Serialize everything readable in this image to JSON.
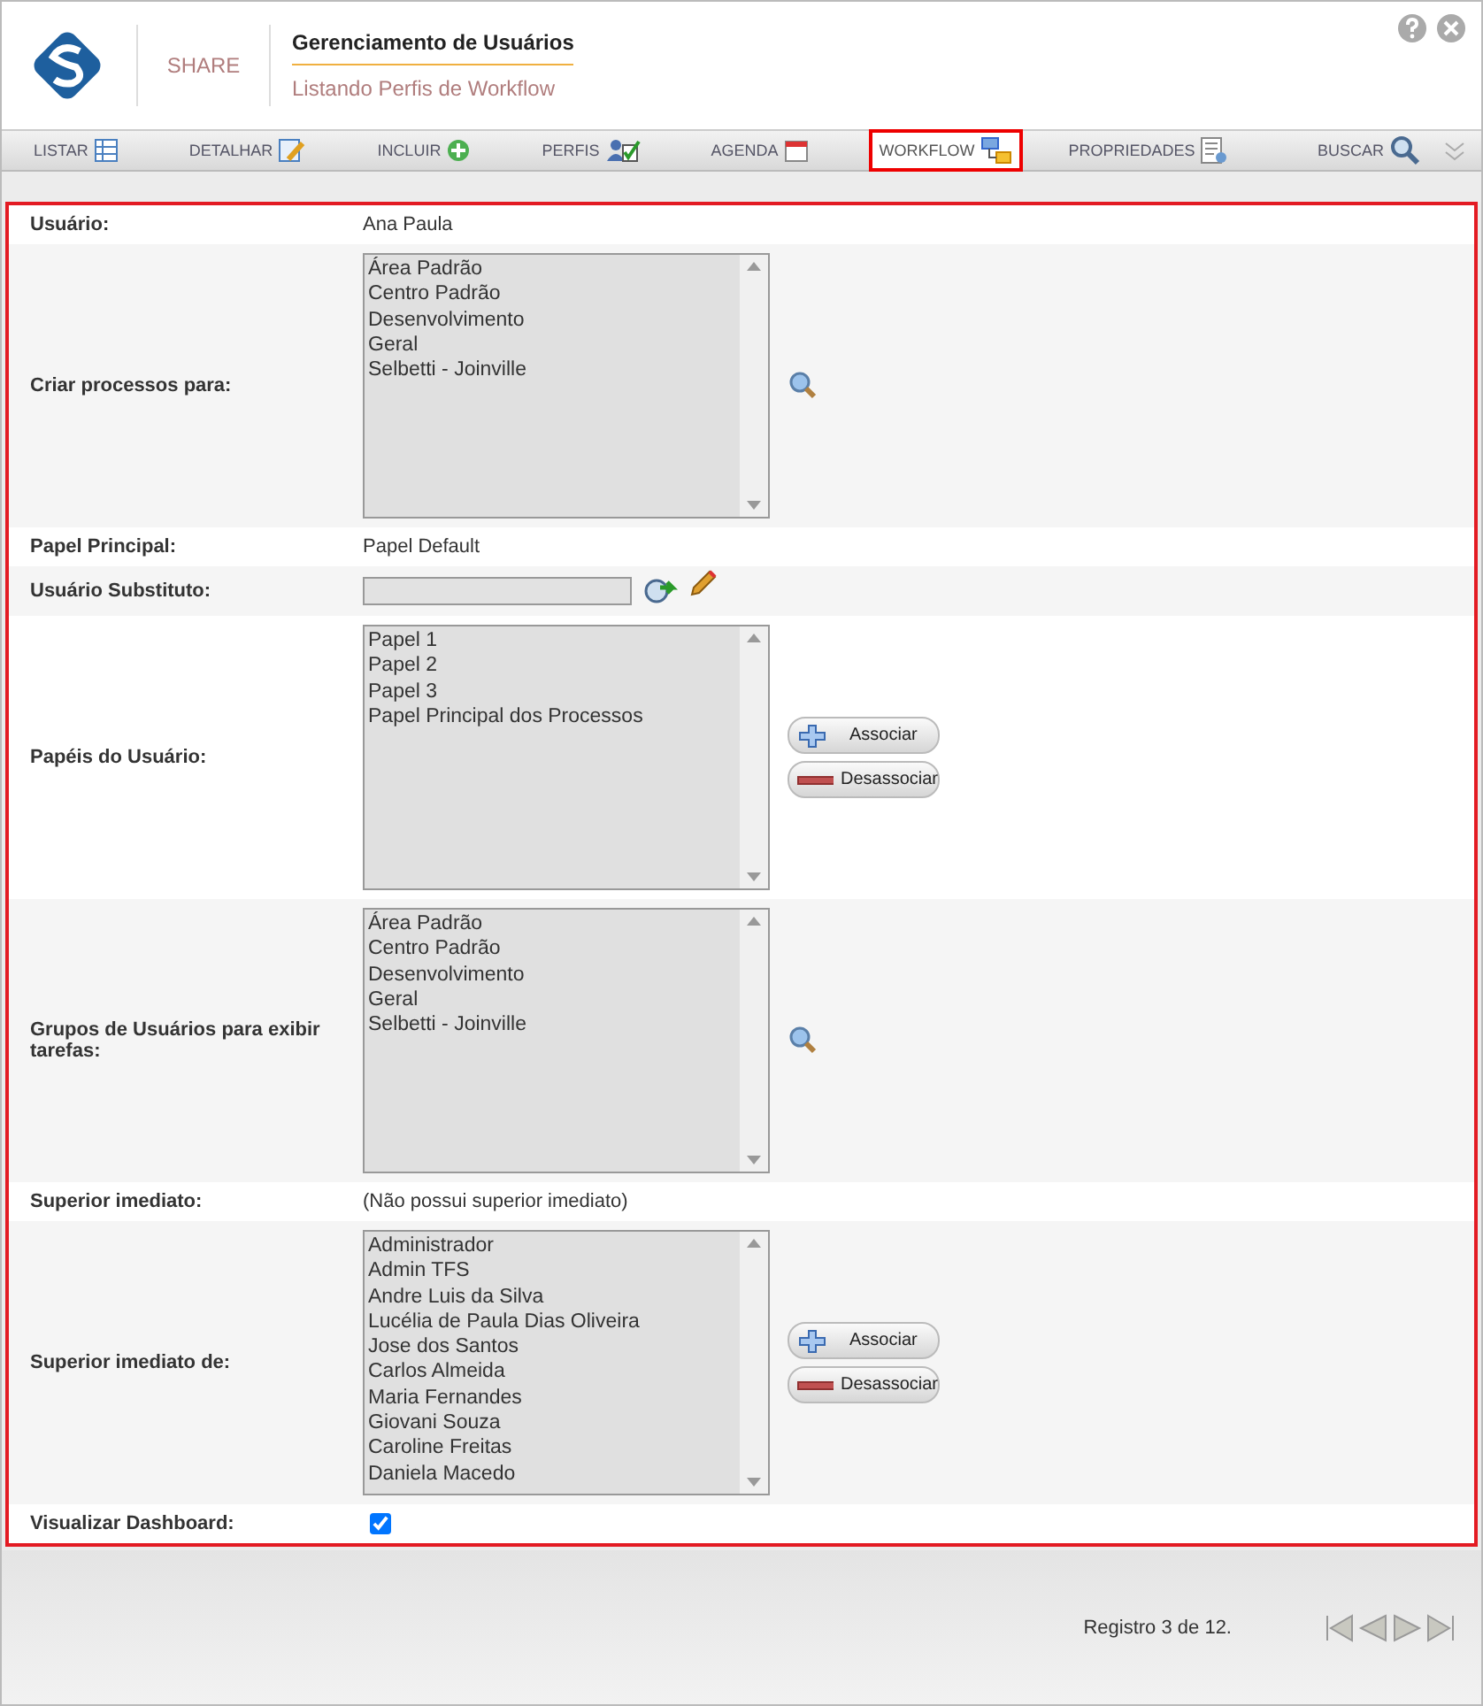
{
  "header": {
    "app_name": "SHARE",
    "title": "Gerenciamento de Usuários",
    "subtitle": "Listando Perfis de Workflow"
  },
  "tabs": [
    {
      "label": "LISTAR",
      "selected": false
    },
    {
      "label": "DETALHAR",
      "selected": false
    },
    {
      "label": "INCLUIR",
      "selected": false
    },
    {
      "label": "PERFIS",
      "selected": false
    },
    {
      "label": "AGENDA",
      "selected": false
    },
    {
      "label": "WORKFLOW",
      "selected": true
    },
    {
      "label": "PROPRIEDADES",
      "selected": false
    }
  ],
  "search_label": "BUSCAR",
  "rows": [
    {
      "kind": "text",
      "label": "Usuário:",
      "value": "Ana Paula"
    },
    {
      "kind": "list_search",
      "label": "Criar processos para:",
      "items": [
        "Área Padrão",
        "Centro Padrão",
        "Desenvolvimento",
        "Geral",
        "Selbetti - Joinville"
      ]
    },
    {
      "kind": "text",
      "label": "Papel Principal:",
      "value": "Papel Default"
    },
    {
      "kind": "input",
      "label": "Usuário Substituto:"
    },
    {
      "kind": "list_buttons",
      "label": "Papéis do Usuário:",
      "items": [
        "Papel 1",
        "Papel 2",
        "Papel 3",
        "Papel Principal dos Processos"
      ],
      "buttons": [
        "Associar",
        "Desassociar"
      ]
    },
    {
      "kind": "list_search",
      "label": "Grupos de Usuários para exibir tarefas:",
      "items": [
        "Área Padrão",
        "Centro Padrão",
        "Desenvolvimento",
        "Geral",
        "Selbetti - Joinville"
      ]
    },
    {
      "kind": "text",
      "label": "Superior imediato:",
      "value": "(Não possui superior imediato)"
    },
    {
      "kind": "list_buttons",
      "label": "Superior imediato de:",
      "items": [
        "Administrador",
        "Admin TFS",
        "Andre Luis da Silva",
        "Lucélia de Paula Dias Oliveira",
        "Jose dos Santos",
        "Carlos Almeida",
        "Maria Fernandes",
        "Giovani Souza",
        "Caroline Freitas",
        "Daniela Macedo"
      ],
      "buttons": [
        "Associar",
        "Desassociar"
      ]
    },
    {
      "kind": "checkbox",
      "label": "Visualizar Dashboard:",
      "checked": true
    }
  ],
  "footer": {
    "record": "Registro 3 de 12."
  }
}
